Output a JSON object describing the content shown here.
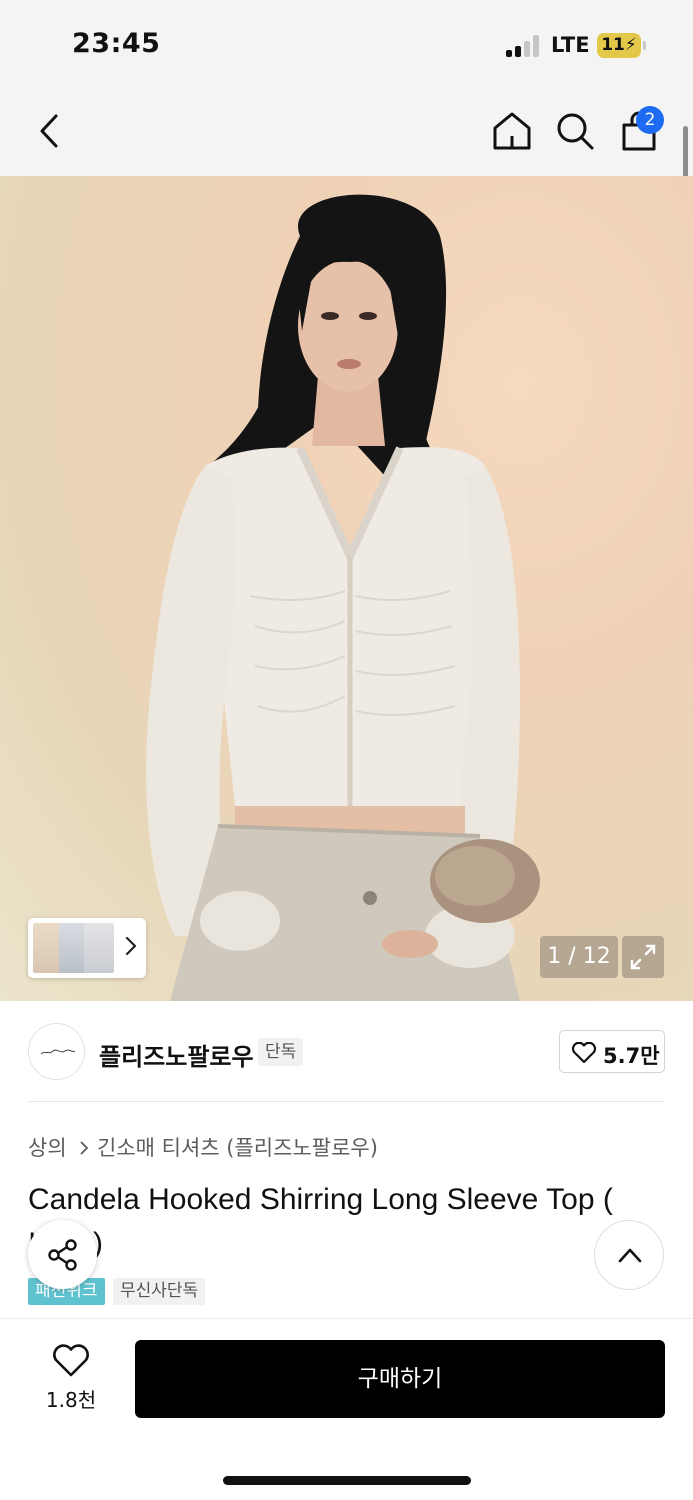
{
  "status_bar": {
    "time": "23:45",
    "network": "LTE",
    "battery_level": "11",
    "battery_color": "#e3c84a",
    "signal_bars_active": 2,
    "signal_bars_total": 4
  },
  "nav": {
    "icons": [
      "chevron-left-icon",
      "home-icon",
      "search-icon",
      "shopping-bag-icon"
    ],
    "cart_count": "2",
    "badge_color": "#1d6bf2"
  },
  "gallery": {
    "counter": "1 / 12",
    "thumbnail_icon": "chevron-right-icon",
    "expand_icon": "expand-arrows-icon"
  },
  "brand": {
    "name": "플리즈노팔로우",
    "exclusive_label": "단독",
    "likes": "5.7만"
  },
  "product": {
    "breadcrumb": [
      "상의",
      "긴소매 티셔츠 (플리즈노팔로우)"
    ],
    "title": "Candela Hooked Shirring Long Sleeve Top ( Ivory)",
    "tags": [
      "패션위크",
      "무신사단독"
    ],
    "tag_accent_color": "#5fc2cf"
  },
  "floating": {
    "share_icon": "share-icon",
    "scroll_top_icon": "chevron-up-icon"
  },
  "bottom_bar": {
    "wish_count": "1.8천",
    "buy_label": "구매하기",
    "buy_color": "#000000"
  }
}
